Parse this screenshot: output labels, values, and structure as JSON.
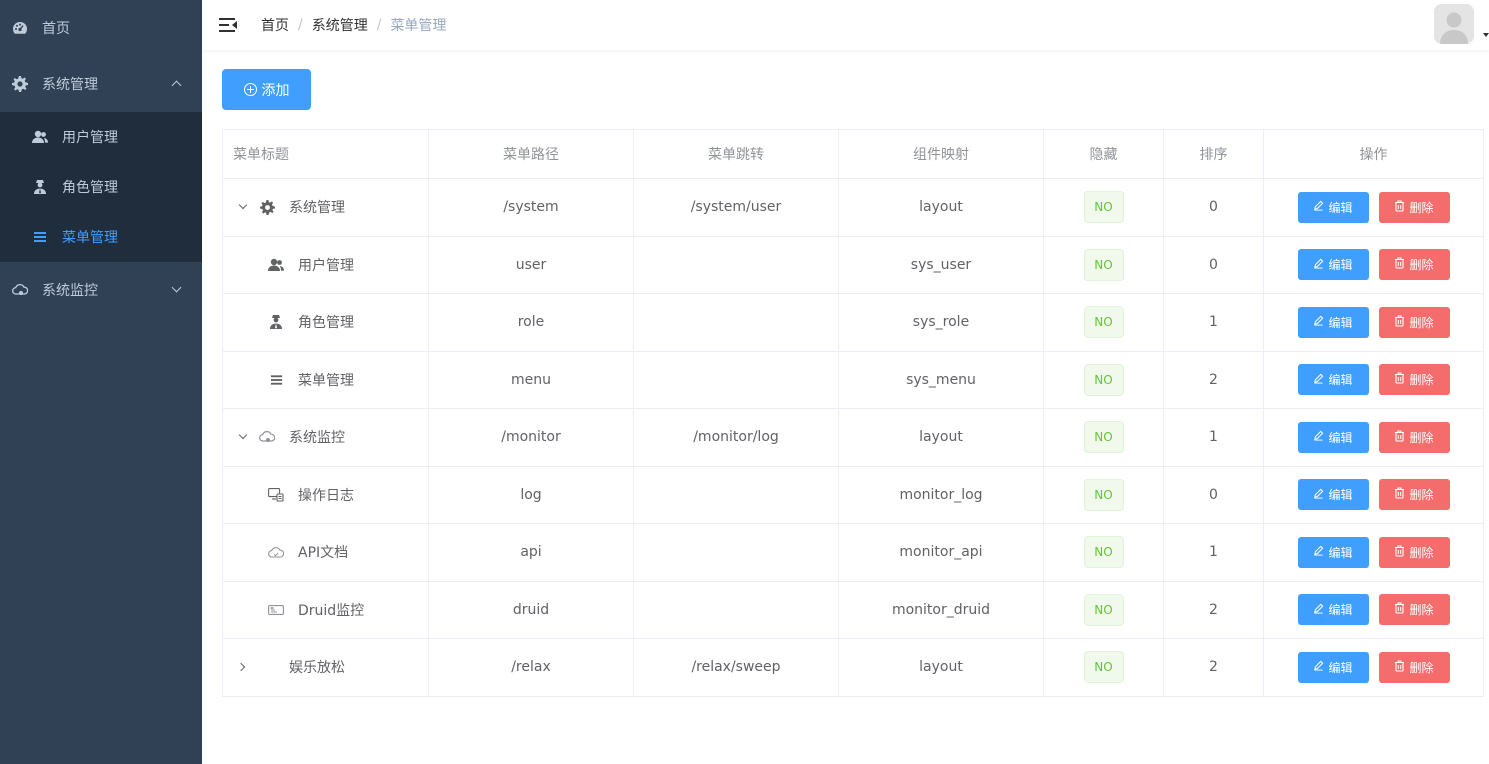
{
  "sidebar": {
    "items": [
      {
        "label": "首页",
        "icon": "dashboard-icon"
      },
      {
        "label": "系统管理",
        "icon": "gear-icon",
        "expanded": true,
        "children": [
          {
            "label": "用户管理",
            "icon": "user-icon"
          },
          {
            "label": "角色管理",
            "icon": "role-icon"
          },
          {
            "label": "菜单管理",
            "icon": "list-icon",
            "active": true
          }
        ]
      },
      {
        "label": "系统监控",
        "icon": "monitor-icon",
        "expanded": false
      }
    ],
    "colors": {
      "bg": "#304156",
      "submenu_bg": "#1f2d3d",
      "text": "#bfcbd9",
      "active": "#409eff"
    }
  },
  "header": {
    "breadcrumb": [
      "首页",
      "系统管理",
      "菜单管理"
    ]
  },
  "toolbar": {
    "add_label": "添加"
  },
  "table": {
    "columns": [
      "菜单标题",
      "菜单路径",
      "菜单跳转",
      "组件映射",
      "隐藏",
      "排序",
      "操作"
    ],
    "rows": [
      {
        "title": "系统管理",
        "path": "/system",
        "redirect": "/system/user",
        "component": "layout",
        "hidden": "NO",
        "sort": "0",
        "level": 0,
        "expand": "open",
        "icon": "gear-icon"
      },
      {
        "title": "用户管理",
        "path": "user",
        "redirect": "",
        "component": "sys_user",
        "hidden": "NO",
        "sort": "0",
        "level": 1,
        "icon": "user-icon"
      },
      {
        "title": "角色管理",
        "path": "role",
        "redirect": "",
        "component": "sys_role",
        "hidden": "NO",
        "sort": "1",
        "level": 1,
        "icon": "role-icon"
      },
      {
        "title": "菜单管理",
        "path": "menu",
        "redirect": "",
        "component": "sys_menu",
        "hidden": "NO",
        "sort": "2",
        "level": 1,
        "icon": "list-icon"
      },
      {
        "title": "系统监控",
        "path": "/monitor",
        "redirect": "/monitor/log",
        "component": "layout",
        "hidden": "NO",
        "sort": "1",
        "level": 0,
        "expand": "open",
        "icon": "monitor-icon"
      },
      {
        "title": "操作日志",
        "path": "log",
        "redirect": "",
        "component": "monitor_log",
        "hidden": "NO",
        "sort": "0",
        "level": 1,
        "icon": "log-icon"
      },
      {
        "title": "API文档",
        "path": "api",
        "redirect": "",
        "component": "monitor_api",
        "hidden": "NO",
        "sort": "1",
        "level": 1,
        "icon": "cloud-icon"
      },
      {
        "title": "Druid监控",
        "path": "druid",
        "redirect": "",
        "component": "monitor_druid",
        "hidden": "NO",
        "sort": "2",
        "level": 1,
        "icon": "druid-icon"
      },
      {
        "title": "娱乐放松",
        "path": "/relax",
        "redirect": "/relax/sweep",
        "component": "layout",
        "hidden": "NO",
        "sort": "2",
        "level": 0,
        "expand": "closed",
        "icon": ""
      }
    ],
    "edit_label": "编辑",
    "delete_label": "删除"
  }
}
